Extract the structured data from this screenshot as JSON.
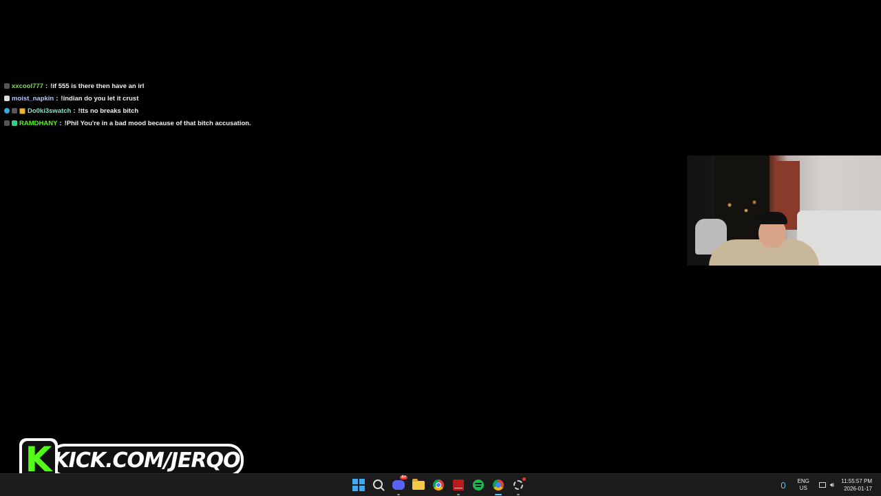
{
  "chat": {
    "messages": [
      {
        "user": "xxcool777",
        "user_color": "#7cdb4a",
        "text": "!if 555 is there then have an irl",
        "badges": [
          "gray"
        ]
      },
      {
        "user": "moist_napkin",
        "user_color": "#b8c6ff",
        "text": "!indian do you let it crust",
        "badges": [
          "white"
        ]
      },
      {
        "user": "Do0ki3swatch",
        "user_color": "#7fe7d0",
        "text": "!tts no breaks bitch",
        "badges": [
          "blue",
          "gray",
          "gold"
        ]
      },
      {
        "user": "RAMDHANY",
        "user_color": "#53fc18",
        "text": "!Phil You're in a bad mood because of that bitch accusation.",
        "badges": [
          "gray",
          "green"
        ]
      }
    ],
    "separator": ":"
  },
  "brand": {
    "letter": "K",
    "url": "KICK.COM/JERQO",
    "accent_color": "#53fc18"
  },
  "taskbar": {
    "apps": [
      {
        "name": "start",
        "icon": "windows-start-icon"
      },
      {
        "name": "search",
        "icon": "search-icon"
      },
      {
        "name": "discord",
        "icon": "discord-icon",
        "badge": "4+"
      },
      {
        "name": "file-explorer",
        "icon": "folder-icon"
      },
      {
        "name": "chrome",
        "icon": "chrome-icon"
      },
      {
        "name": "red-app",
        "icon": "red-app-icon"
      },
      {
        "name": "spotify",
        "icon": "spotify-icon"
      },
      {
        "name": "chrome-active",
        "icon": "chrome-icon"
      },
      {
        "name": "settings",
        "icon": "gear-icon"
      }
    ],
    "language": {
      "line1": "ENG",
      "line2": "US"
    },
    "time": "11:55:57 PM",
    "date": "2026-01-17"
  }
}
